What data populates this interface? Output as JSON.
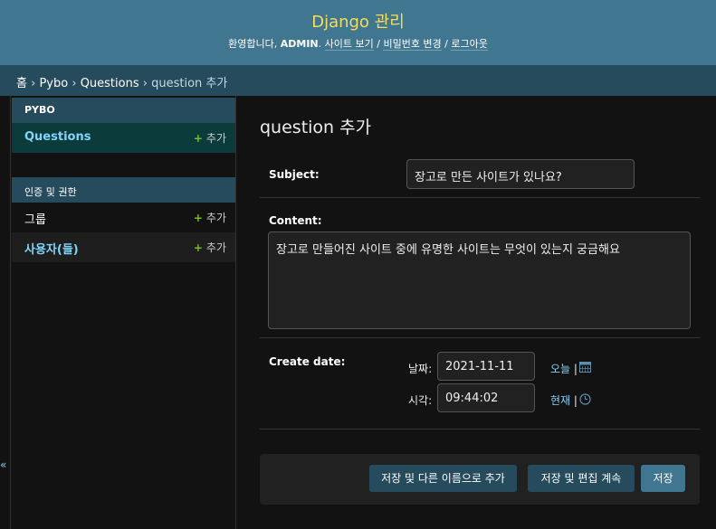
{
  "header": {
    "title": "Django 관리",
    "welcome": "환영합니다,",
    "username": "ADMIN",
    "view_site": "사이트 보기",
    "change_password": "비밀번호 변경",
    "logout": "로그아웃",
    "separator": "/"
  },
  "breadcrumbs": [
    "홈",
    "Pybo",
    "Questions",
    "question 추가"
  ],
  "breadcrumb_separator": "›",
  "sidebar": {
    "apps": [
      {
        "caption": "PYBO",
        "models": [
          {
            "name": "Questions",
            "add": "추가",
            "active": true
          }
        ]
      },
      {
        "caption": "인증 및 권한",
        "models": [
          {
            "name": "그룹",
            "add": "추가"
          },
          {
            "name": "사용자(들)",
            "add": "추가"
          }
        ]
      }
    ],
    "collapse_glyph": "«"
  },
  "form": {
    "title": "question 추가",
    "subject_label": "Subject:",
    "subject_value": "장고로 만든 사이트가 있나요?",
    "content_label": "Content:",
    "content_value": "장고로 만들어진 사이트 중에 유명한 사이트는 무엇이 있는지 궁금해요",
    "create_date_label": "Create date:",
    "date_label": "날짜:",
    "date_value": "2021-11-11",
    "today_link": "오늘",
    "time_label": "시각:",
    "time_value": "09:44:02",
    "now_link": "현재"
  },
  "buttons": {
    "save_add_another": "저장 및 다른 이름으로 추가",
    "save_continue": "저장 및 편집 계속",
    "save": "저장"
  },
  "colors": {
    "header_bg": "#417690",
    "title": "#f5dd5d",
    "breadcrumbs_bg": "#264b5d",
    "link": "#81d4fa",
    "add_plus": "#70bf2b",
    "page_bg": "#121212"
  },
  "icons": [
    "calendar-icon",
    "clock-icon",
    "add-plus-icon"
  ]
}
